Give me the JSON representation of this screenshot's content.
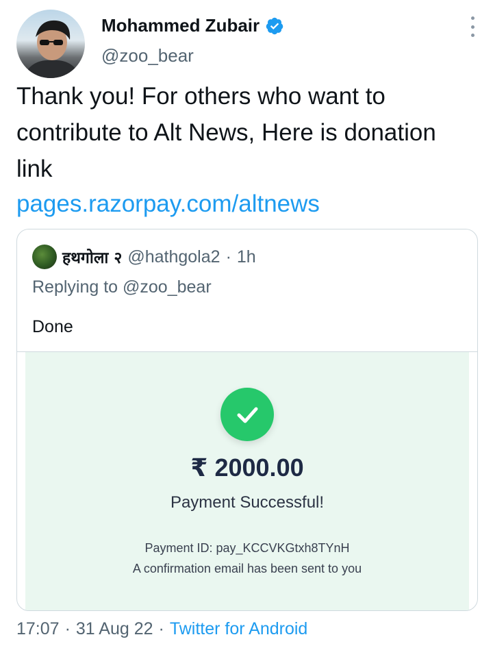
{
  "author": {
    "name": "Mohammed Zubair",
    "handle": "@zoo_bear",
    "verified": true
  },
  "tweet": {
    "text": "Thank you! For others who want to contribute to Alt News, Here is donation link",
    "link": "pages.razorpay.com/altnews"
  },
  "quoted_tweet": {
    "name": "हथगोला २",
    "handle": "@hathgola2",
    "separator": "·",
    "time": "1h",
    "replying_to": "Replying to @zoo_bear",
    "text": "Done",
    "payment": {
      "currency_symbol": "₹",
      "amount_main": "2000.",
      "amount_cents": "00",
      "status": "Payment Successful!",
      "payment_id": "Payment ID: pay_KCCVKGtxh8TYnH",
      "confirmation": "A confirmation email has been sent to you"
    }
  },
  "footer": {
    "time": "17:07",
    "separator": "·",
    "date": "31 Aug 22",
    "separator2": "·",
    "source": "Twitter for Android"
  },
  "colors": {
    "link": "#1d9bf0",
    "verified_badge": "#1d9bf0",
    "success_green": "#26c86b",
    "payment_bg": "#eaf7f0"
  }
}
